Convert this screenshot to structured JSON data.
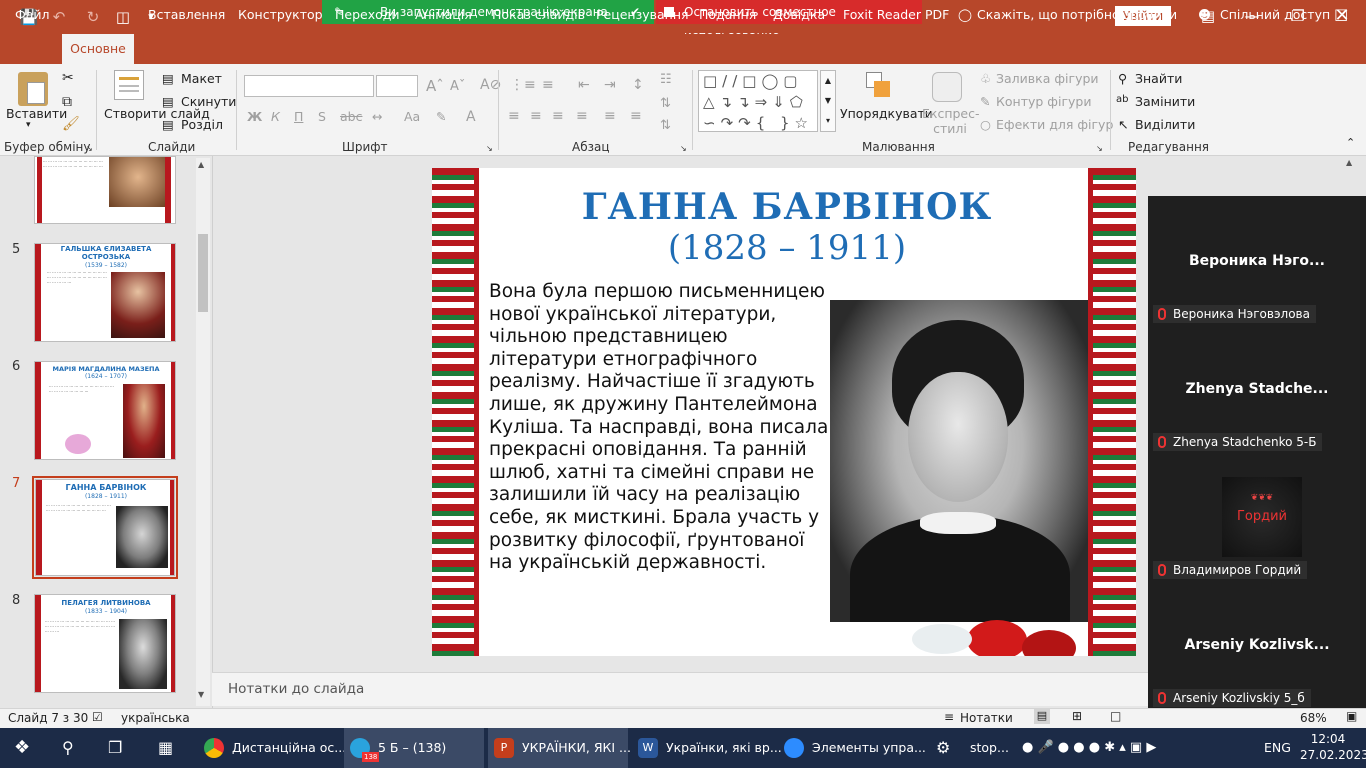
{
  "share": {
    "on_text": "Ви запустили демонстрацію екрана",
    "off_text": "Остановить совместное использование"
  },
  "titlebar": {
    "sign_in": "Увійти"
  },
  "tabs": [
    "Файл",
    "Основне",
    "Вставлення",
    "Конструктор",
    "Переходи",
    "Анімація",
    "Показ слайдів",
    "Рецензування",
    "Подання",
    "Довідка",
    "Foxit Reader PDF",
    "Скажіть, що потрібно зробити",
    "Спільний доступ"
  ],
  "ribbon": {
    "paste": "Вставити",
    "new_slide": "Створити слайд",
    "layout": "Макет",
    "reset": "Скинути",
    "section": "Розділ",
    "arrange": "Упорядкувати",
    "express_styles": "Експрес-стилі",
    "shape_fill": "Заливка фігури",
    "shape_outline": "Контур фігури",
    "shape_effects": "Ефекти для фігур",
    "find": "Знайти",
    "replace": "Замінити",
    "select": "Виділити",
    "bold": "Ж",
    "italic": "К",
    "underline": "П",
    "strike": "S",
    "groups": {
      "clipboard": "Буфер обміну",
      "slides": "Слайди",
      "font": "Шрифт",
      "paragraph": "Абзац",
      "drawing": "Малювання",
      "editing": "Редагування"
    }
  },
  "thumbnails": [
    {
      "num": "5",
      "title": "ГАЛЬШКА ЄЛИЗАВЕТА ОСТРОЗЬКА",
      "years": "(1539 – 1582)"
    },
    {
      "num": "6",
      "title": "МАРІЯ МАГДАЛИНА МАЗЕПА",
      "years": "(1624 – 1707)"
    },
    {
      "num": "7",
      "title": "ГАННА БАРВІНОК",
      "years": "(1828 – 1911)"
    },
    {
      "num": "8",
      "title": "ПЕЛАГЕЯ ЛИТВИНОВА",
      "years": "(1833 – 1904)"
    }
  ],
  "slide": {
    "title": "ГАННА БАРВІНОК",
    "years": "(1828 – 1911)",
    "body": " Вона була першою письменницею нової української літератури, чільною представницею літератури етнографічного реалізму. Найчастіше її згадують лише, як дружину Пантелеймона Куліша. Та насправді, вона писала прекрасні оповідання. Та ранній шлюб, хатні та сімейні справи не залишили їй часу на реалізацію себе, як мисткині. Брала участь у розвитку філософії, ґрунтованої на українській державності."
  },
  "notes_placeholder": "Нотатки до слайда",
  "meeting": [
    {
      "display": "Вероника  Нэго...",
      "label": "Вероника Нэговэлова"
    },
    {
      "display": "Zhenya  Stadche...",
      "label": "Zhenya Stadchenko 5-Б"
    },
    {
      "display": "Гордий",
      "label": "Владимиров Гордий"
    },
    {
      "display": "Arseniy  Kozlivsk...",
      "label": "Arseniy Kozlivskiy 5_б"
    }
  ],
  "status": {
    "slide": "Слайд 7 з 30",
    "lang": "українська",
    "notes": "Нотатки",
    "zoom": "68%"
  },
  "taskbar": {
    "chrome": "Дистанційна ос...",
    "telegram": "5 Б – (138)",
    "telegram_badge": "138",
    "ppt": "УКРАЇНКИ, ЯКІ ...",
    "word": "Українки, які вр...",
    "zoom": "Элементы упра...",
    "stop": "stop...",
    "lang": "ENG",
    "time": "12:04",
    "date": "27.02.2023"
  },
  "colors": {
    "ppt_red": "#b7472a",
    "share_green": "#21a345",
    "share_red": "#d72b2b",
    "title_blue": "#1f6db5",
    "taskbar": "#1c2b47"
  }
}
